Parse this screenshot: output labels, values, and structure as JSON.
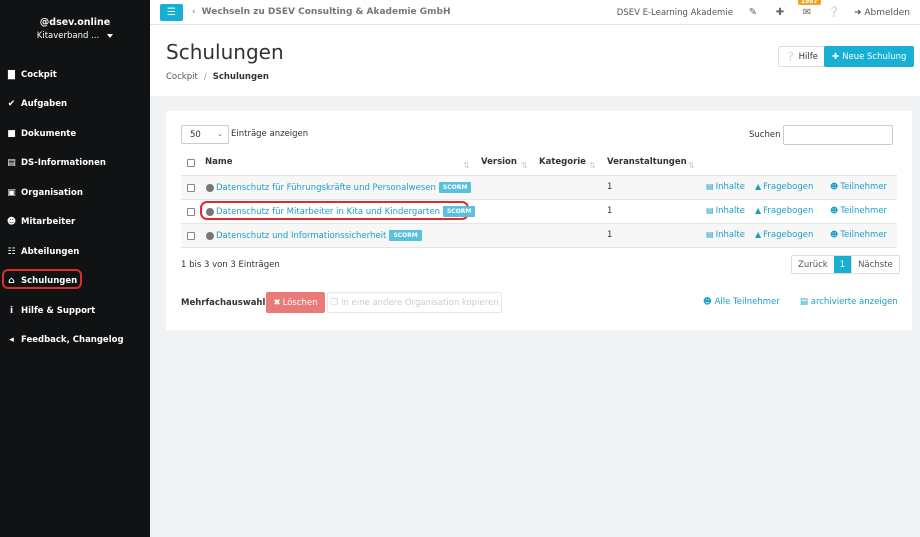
{
  "sidebar": {
    "user_name": "@dsev.online",
    "org_name": "Kitaverband ...",
    "items": [
      {
        "label": "Cockpit",
        "icon": "chart-icon",
        "glyph": "▇"
      },
      {
        "label": "Aufgaben",
        "icon": "tasks-icon",
        "glyph": "✔"
      },
      {
        "label": "Dokumente",
        "icon": "folder-icon",
        "glyph": "■"
      },
      {
        "label": "DS-Informationen",
        "icon": "document-icon",
        "glyph": "▤"
      },
      {
        "label": "Organisation",
        "icon": "building-icon",
        "glyph": "▣"
      },
      {
        "label": "Mitarbeiter",
        "icon": "users-icon",
        "glyph": "☻"
      },
      {
        "label": "Abteilungen",
        "icon": "departments-icon",
        "glyph": "☷"
      },
      {
        "label": "Schulungen",
        "icon": "school-icon",
        "glyph": "⌂"
      },
      {
        "label": "Hilfe & Support",
        "icon": "info-icon",
        "glyph": "i"
      },
      {
        "label": "Feedback, Changelog",
        "icon": "megaphone-icon",
        "glyph": "◂"
      }
    ]
  },
  "topbar": {
    "switch_text": "Wechseln zu DSEV Consulting & Akademie GmbH",
    "academy": "DSEV E-Learning Akademie",
    "badge_count": "1987",
    "logout": "Abmelden"
  },
  "header": {
    "title": "Schulungen",
    "breadcrumb_root": "Cockpit",
    "breadcrumb_current": "Schulungen",
    "help_label": "Hilfe",
    "new_label": "Neue Schulung"
  },
  "table": {
    "length_value": "50",
    "length_label": "Einträge anzeigen",
    "search_label": "Suchen",
    "search_value": "",
    "columns": [
      "Name",
      "Version",
      "Kategorie",
      "Veranstaltungen"
    ],
    "rows": [
      {
        "name": "Datenschutz für Führungskräfte und Personalwesen",
        "tag": "SCORM",
        "events": "1"
      },
      {
        "name": "Datenschutz für Mitarbeiter in Kita und Kindergarten",
        "tag": "SCORM",
        "events": "1"
      },
      {
        "name": "Datenschutz und Informationssicherheit",
        "tag": "SCORM",
        "events": "1"
      }
    ],
    "actions": {
      "content": "Inhalte",
      "questionnaire": "Fragebogen",
      "participants": "Teilnehmer"
    },
    "info": "1 bis 3 von 3 Einträgen",
    "pager": {
      "prev": "Zurück",
      "current": "1",
      "next": "Nächste"
    }
  },
  "bulk": {
    "label": "Mehrfachauswahl:",
    "delete": "Löschen",
    "copy": "In eine andere Organisation kopieren",
    "all_participants": "Alle Teilnehmer",
    "archived": "archivierte anzeigen"
  },
  "colors": {
    "accent": "#17b0d4",
    "link": "#1b9fc6",
    "danger": "#e87a78",
    "sidebar": "#101213",
    "highlight": "#e02b2b"
  }
}
